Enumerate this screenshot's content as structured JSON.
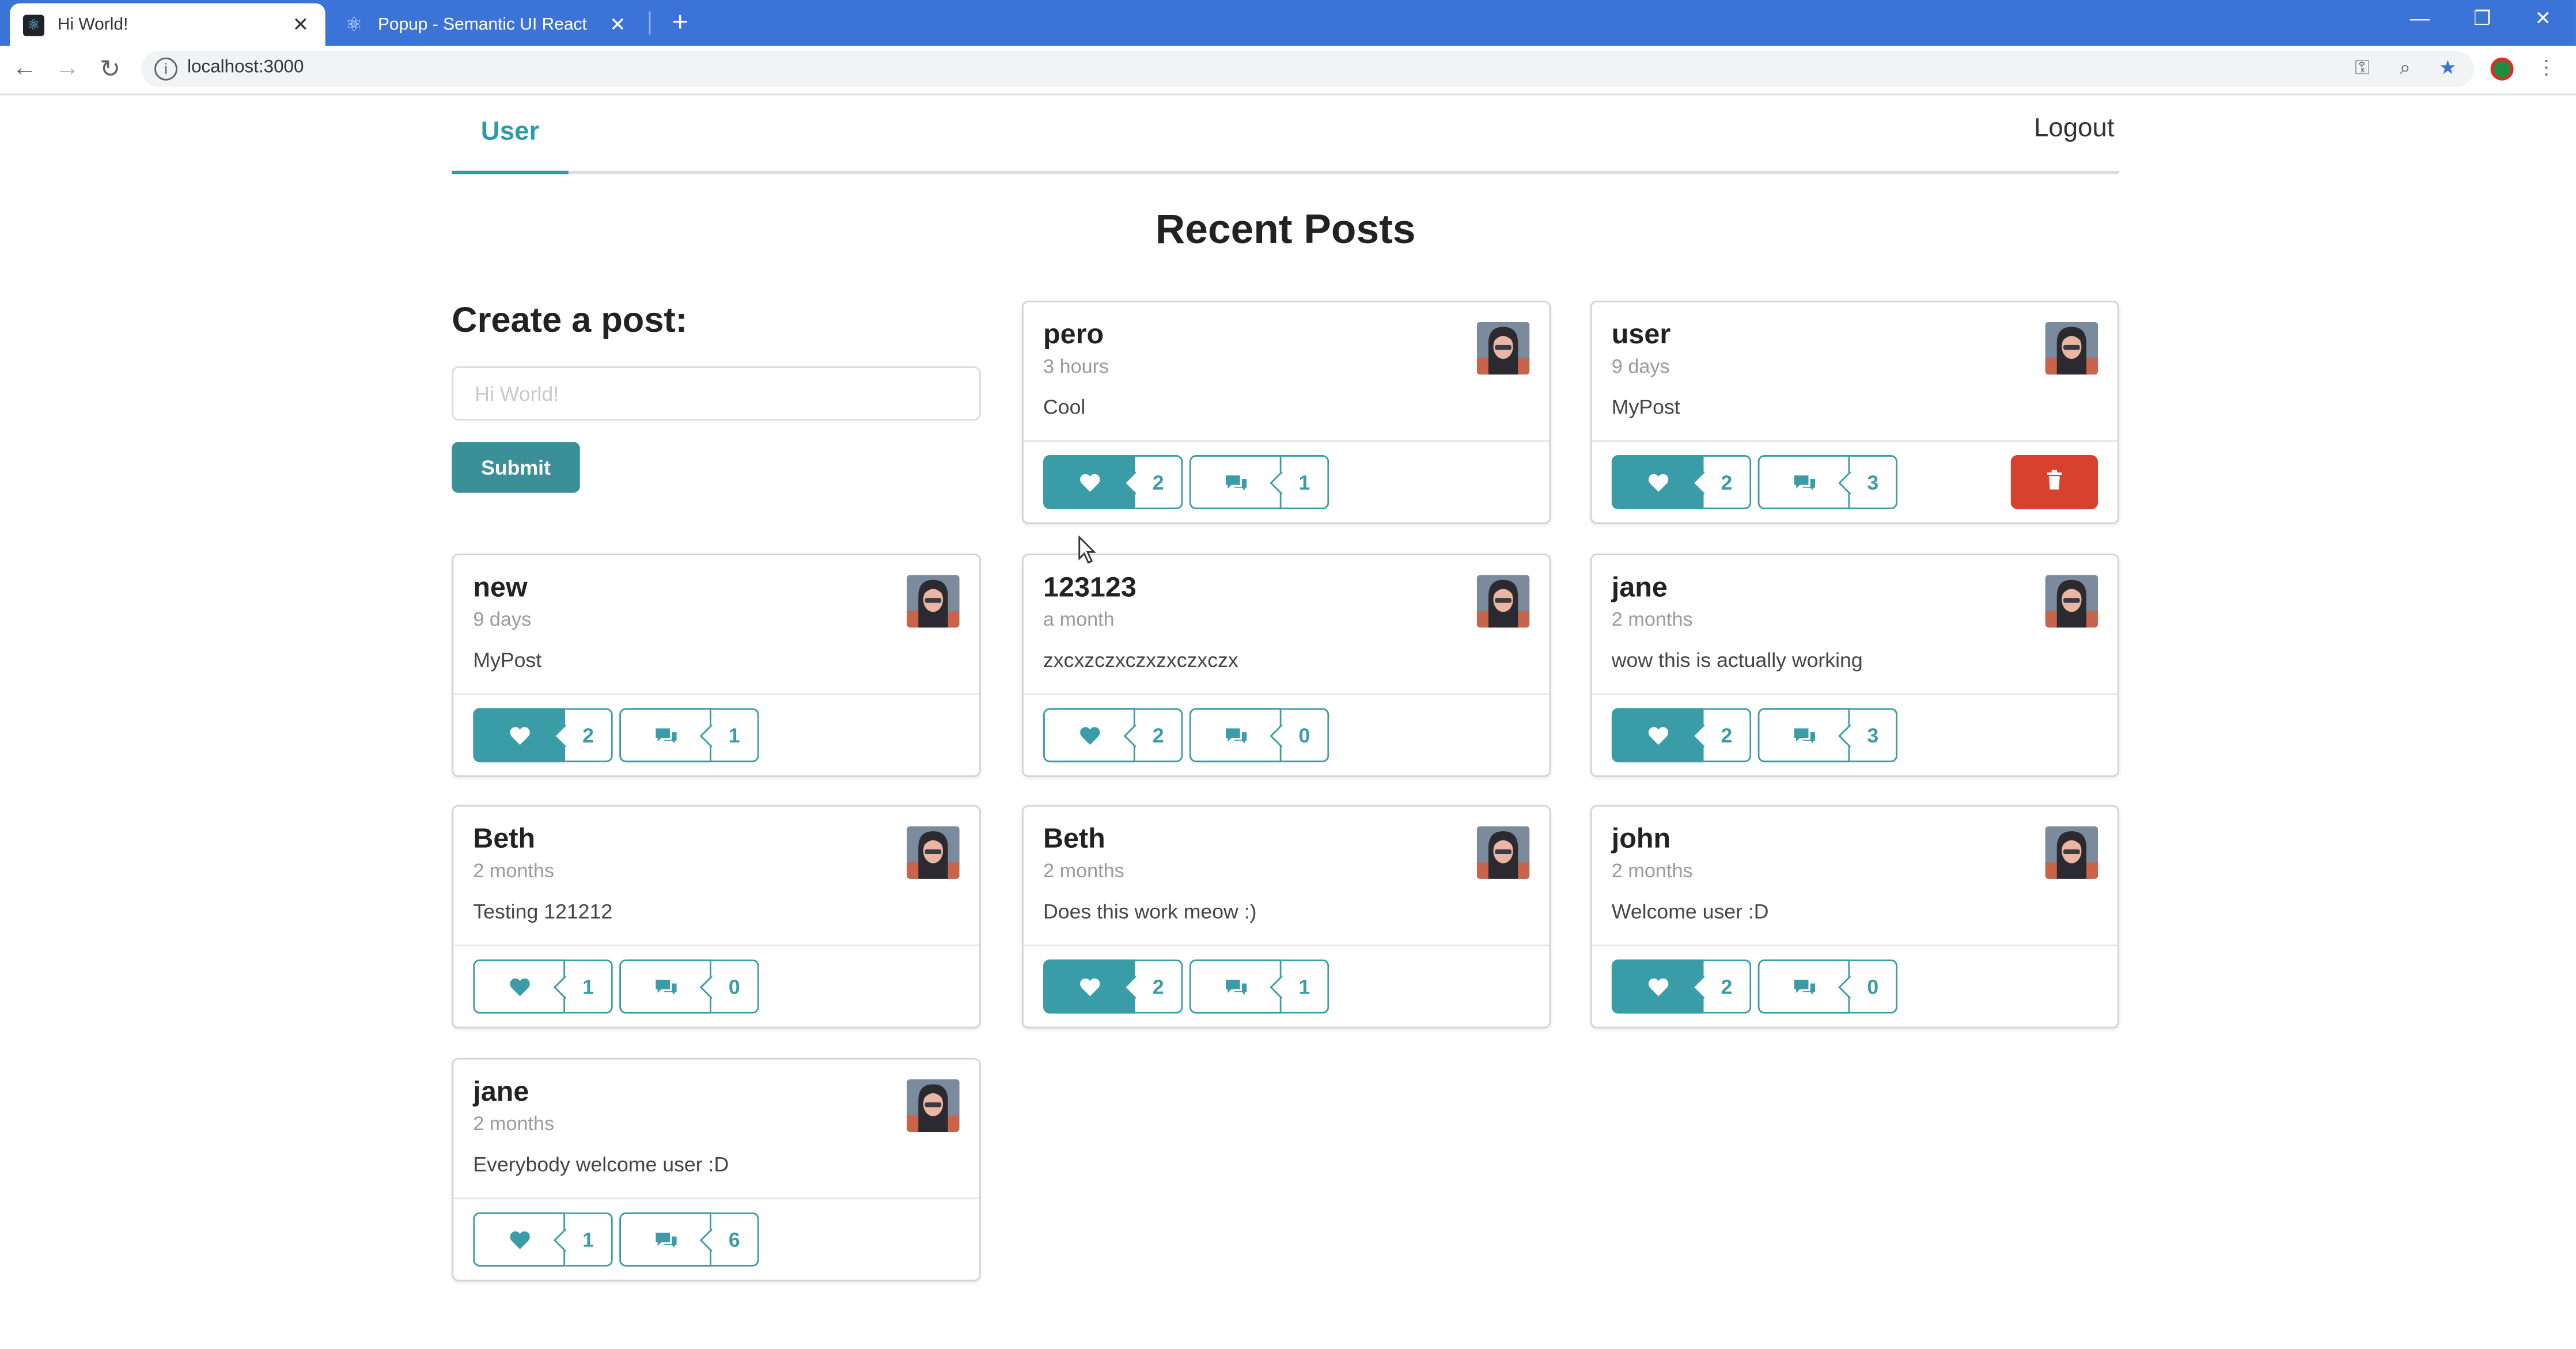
{
  "browser": {
    "tabs": [
      {
        "title": "Hi World!",
        "favicon": "react-icon",
        "active": true
      },
      {
        "title": "Popup - Semantic UI React",
        "favicon": "react-icon",
        "active": false
      }
    ],
    "url": "localhost:3000"
  },
  "menu": {
    "user_label": "User",
    "logout_label": "Logout"
  },
  "page_title": "Recent Posts",
  "create": {
    "title": "Create a post:",
    "placeholder": "Hi World!",
    "submit_label": "Submit"
  },
  "posts": [
    {
      "author": "pero",
      "time": "3 hours",
      "body": "Cool",
      "likes": "2",
      "comments": "1",
      "liked": true,
      "deletable": false
    },
    {
      "author": "user",
      "time": "9 days",
      "body": "MyPost",
      "likes": "2",
      "comments": "3",
      "liked": true,
      "deletable": true
    },
    {
      "author": "new",
      "time": "9 days",
      "body": "MyPost",
      "likes": "2",
      "comments": "1",
      "liked": true,
      "deletable": false
    },
    {
      "author": "123123",
      "time": "a month",
      "body": "zxcxzczxczxzxczxczx",
      "likes": "2",
      "comments": "0",
      "liked": false,
      "deletable": false
    },
    {
      "author": "jane",
      "time": "2 months",
      "body": "wow this is actually working",
      "likes": "2",
      "comments": "3",
      "liked": true,
      "deletable": false
    },
    {
      "author": "Beth",
      "time": "2 months",
      "body": "Testing 121212",
      "likes": "1",
      "comments": "0",
      "liked": false,
      "deletable": false
    },
    {
      "author": "Beth",
      "time": "2 months",
      "body": "Does this work meow :)",
      "likes": "2",
      "comments": "1",
      "liked": true,
      "deletable": false
    },
    {
      "author": "john",
      "time": "2 months",
      "body": "Welcome user :D",
      "likes": "2",
      "comments": "0",
      "liked": true,
      "deletable": false
    },
    {
      "author": "jane",
      "time": "2 months",
      "body": "Everybody welcome user :D",
      "likes": "1",
      "comments": "6",
      "liked": false,
      "deletable": false
    }
  ],
  "colors": {
    "accent": "#3a9ca6",
    "delete": "#d9412f",
    "tabbar": "#3b74d6"
  }
}
